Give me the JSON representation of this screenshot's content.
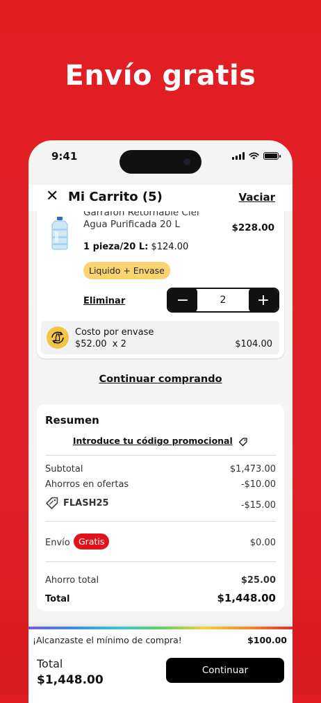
{
  "promo": {
    "title": "Envío gratis"
  },
  "status": {
    "time": "9:41"
  },
  "header": {
    "title": "Mi Carrito (5)",
    "clear": "Vaciar"
  },
  "product": {
    "name_line1": "Garrafón Retornable Ciel",
    "name_line2": "Agua Purificada 20 L",
    "price": "$228.00",
    "unit_label": "1 pieza/20 L:",
    "unit_price": "$124.00",
    "tag": "Liquido + Envase",
    "remove": "Eliminar",
    "quantity": "2",
    "deposit": {
      "label": "Costo por envase",
      "detail": "$52.00  x 2",
      "total": "$104.00"
    }
  },
  "continue_shopping": "Continuar comprando",
  "summary": {
    "title": "Resumen",
    "promo_link": "Introduce tu código promocional",
    "subtotal_label": "Subtotal",
    "subtotal": "$1,473.00",
    "savings_label": "Ahorros en ofertas",
    "savings": "-$10.00",
    "code": "FLASH25",
    "code_discount": "-$15.00",
    "shipping_label": "Envío",
    "shipping_badge": "Gratis",
    "shipping": "$0.00",
    "total_savings_label": "Ahorro total",
    "total_savings": "$25.00",
    "total_label": "Total",
    "total": "$1,448.00"
  },
  "footer": {
    "minimum_text": "¡Alcanzaste el mínimo de compra!",
    "minimum_value": "$100.00",
    "total_label": "Total",
    "total": "$1,448.00",
    "continue": "Continuar"
  },
  "colors": {
    "brand_red": "#e01e22",
    "badge_yellow": "#fbd470",
    "deposit_icon": "#f4c445"
  },
  "icons": [
    "close-icon",
    "signal-icon",
    "wifi-icon",
    "battery-icon",
    "minus-icon",
    "plus-icon",
    "bottle-refresh-icon",
    "tag-icon"
  ]
}
